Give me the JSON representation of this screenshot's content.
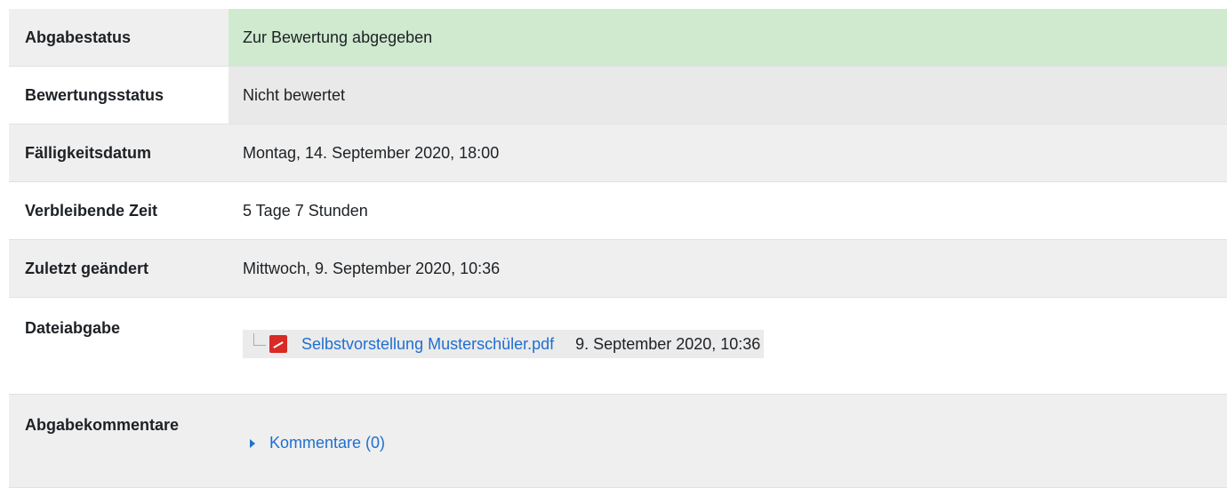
{
  "rows": [
    {
      "label": "Abgabestatus",
      "value": "Zur Bewertung abgegeben"
    },
    {
      "label": "Bewertungsstatus",
      "value": "Nicht bewertet"
    },
    {
      "label": "Fälligkeitsdatum",
      "value": "Montag, 14. September 2020, 18:00"
    },
    {
      "label": "Verbleibende Zeit",
      "value": "5 Tage 7 Stunden"
    },
    {
      "label": "Zuletzt geändert",
      "value": "Mittwoch, 9. September 2020, 10:36"
    }
  ],
  "file_submission": {
    "label": "Dateiabgabe",
    "file_name": "Selbstvorstellung Musterschüler.pdf",
    "file_date": "9. September 2020, 10:36"
  },
  "comments": {
    "label": "Abgabekommentare",
    "toggle_label": "Kommentare (0)"
  },
  "colors": {
    "status_submitted": "#cfeacf",
    "grading_status": "#e9e9e9",
    "link": "#1f6fd1",
    "pdf_icon": "#d92a26"
  },
  "icons": {
    "file": "pdf-icon",
    "toggle": "caret-right-icon"
  }
}
